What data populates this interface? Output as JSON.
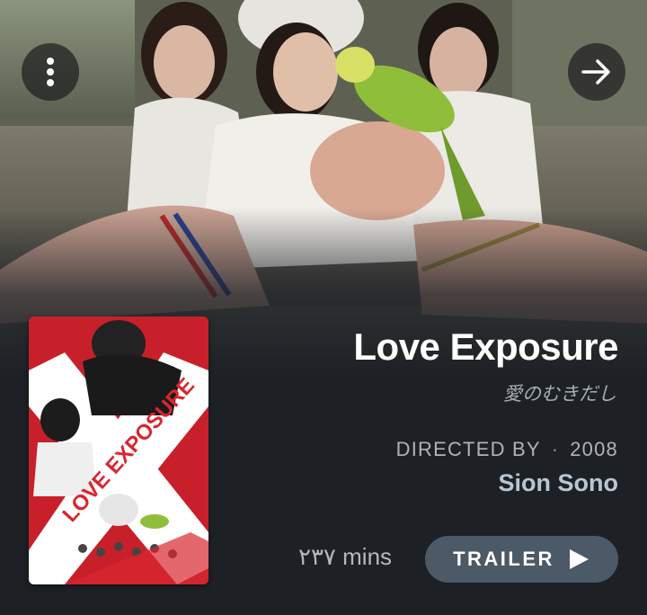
{
  "movie": {
    "title": "Love Exposure",
    "original_title": "愛のむきだし",
    "directed_by_label": "DIRECTED BY",
    "separator": "·",
    "year": "2008",
    "director": "Sion Sono",
    "runtime": "٢٣٧ mins",
    "poster_title": "LOVE EXPOSURE"
  },
  "actions": {
    "trailer_label": "TRAILER",
    "menu_icon": "more-vert-icon",
    "next_icon": "arrow-right-icon",
    "trailer_icon": "play-icon"
  },
  "colors": {
    "background": "#1d2126",
    "trailer_button": "#4c5967",
    "poster_red": "#c8202a"
  }
}
